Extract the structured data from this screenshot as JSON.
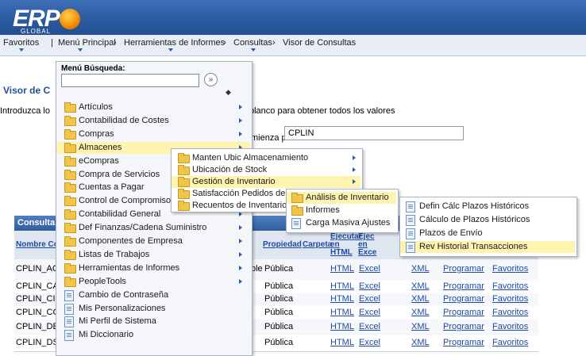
{
  "header": {
    "logo_text": "ERP",
    "logo_sub": "GLOBAL"
  },
  "breadcrumb": {
    "favoritos": "Favoritos",
    "menu_principal": "Menú Principal",
    "sep": "›",
    "herramientas": "Herramientas de Informes",
    "consultas": "Consultas",
    "visor": "Visor de Consultas"
  },
  "page": {
    "title": "Visor de C",
    "intro_left": "Introduzca lo",
    "intro_right": "blanco para obtener todos los valores",
    "search_label": "mienza por",
    "search_value": "CPLIN",
    "grid_caption": "Consulta",
    "col_nombre": "Nombre Co",
    "col_propiedad": "Propiedad",
    "col_carpeta": "Carpeta",
    "col_ejec1": "Ejecutar en HTML",
    "col_ejec2": "Ejec en Exce",
    "rows": [
      {
        "name": "CPLIN_AC",
        "frag": "ble",
        "prop": "Pública"
      },
      {
        "name": "CPLIN_CA",
        "frag": "",
        "prop": "Pública"
      },
      {
        "name": "CPLIN_CII",
        "frag": "l",
        "prop": "Pública"
      },
      {
        "name": "CPLIN_CC",
        "frag": "",
        "prop": "Pública"
      },
      {
        "name": "CPLIN_DE",
        "frag": "",
        "prop": "Pública"
      },
      {
        "name": "CPLIN_DS",
        "frag": "",
        "prop": "Pública"
      }
    ],
    "link_html": "HTML",
    "link_excel": "Excel",
    "link_xml": "XML",
    "link_programar": "Programar",
    "link_favoritos": "Favoritos"
  },
  "menu1": {
    "search_label": "Menú Búsqueda:",
    "items": [
      {
        "label": "Artículos",
        "icon": "folder-icon",
        "sub": true
      },
      {
        "label": "Contabilidad de Costes",
        "icon": "folder-icon",
        "sub": true
      },
      {
        "label": "Compras",
        "icon": "folder-icon",
        "sub": true
      },
      {
        "label": "Almacenes",
        "icon": "folder-icon",
        "sub": true
      },
      {
        "label": "eCompras",
        "icon": "folder-icon",
        "sub": true
      },
      {
        "label": "Compra de Servicios",
        "icon": "folder-icon",
        "sub": true
      },
      {
        "label": "Cuentas a Pagar",
        "icon": "folder-icon",
        "sub": true
      },
      {
        "label": "Control de Compromisos",
        "icon": "folder-icon",
        "sub": true
      },
      {
        "label": "Contabilidad General",
        "icon": "folder-icon",
        "sub": true
      },
      {
        "label": "Def Finanzas/Cadena Suministro",
        "icon": "folder-icon",
        "sub": true
      },
      {
        "label": "Componentes de Empresa",
        "icon": "folder-icon",
        "sub": true
      },
      {
        "label": "Listas de Trabajos",
        "icon": "folder-icon",
        "sub": true
      },
      {
        "label": "Herramientas de Informes",
        "icon": "folder-icon",
        "sub": true
      },
      {
        "label": "PeopleTools",
        "icon": "folder-icon",
        "sub": true
      },
      {
        "label": "Cambio de Contraseña",
        "icon": "document-icon",
        "sub": false
      },
      {
        "label": "Mis Personalizaciones",
        "icon": "document-icon",
        "sub": false
      },
      {
        "label": "Mi Perfil de Sistema",
        "icon": "document-icon",
        "sub": false
      },
      {
        "label": "Mi Diccionario",
        "icon": "document-icon",
        "sub": false
      }
    ]
  },
  "menu2": {
    "items": [
      {
        "label": "Manten Ubic Almacenamiento",
        "sub": true
      },
      {
        "label": "Ubicación de Stock",
        "sub": true
      },
      {
        "label": "Gestión de Inventario",
        "sub": true
      },
      {
        "label": "Satisfacción Pedidos de St",
        "sub": false
      },
      {
        "label": "Recuentos de Inventario",
        "sub": true
      }
    ]
  },
  "menu3": {
    "items": [
      {
        "label": "Análisis de Inventario",
        "icon": "folder-icon"
      },
      {
        "label": "Informes",
        "icon": "folder-icon"
      },
      {
        "label": "Carga Masiva Ajustes",
        "icon": "document-icon"
      }
    ]
  },
  "menu4": {
    "items": [
      {
        "label": "Defin Cálc Plazos Históricos"
      },
      {
        "label": "Cálculo de Plazos Históricos"
      },
      {
        "label": "Plazos de Envío"
      },
      {
        "label": "Rev Historial Transacciones"
      }
    ]
  },
  "colors": {
    "header": "#2c5aa0",
    "highlight": "#fff3b0",
    "link": "#1d4aa8"
  }
}
